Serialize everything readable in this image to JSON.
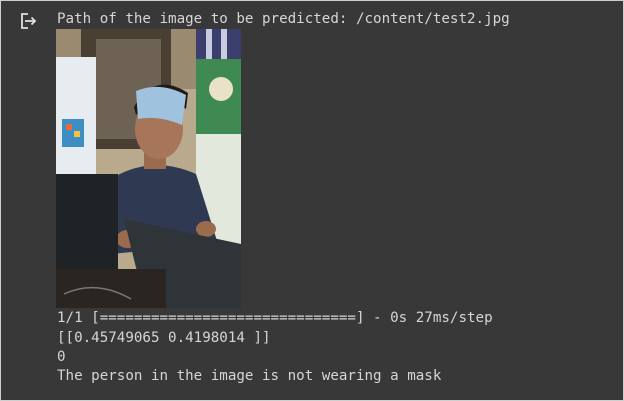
{
  "output": {
    "icon": "output-redirect-icon",
    "path_line": "Path of the image to be predicted: /content/test2.jpg",
    "progress_line": "1/1 [==============================] - 0s 27ms/step",
    "prediction_line": "[[0.45749065 0.4198014 ]]",
    "class_line": "0",
    "result_line": "The person in the image is not wearing a mask"
  },
  "colors": {
    "background": "#383838",
    "text": "#d6d6d6",
    "icon": "#e0e0e0"
  }
}
